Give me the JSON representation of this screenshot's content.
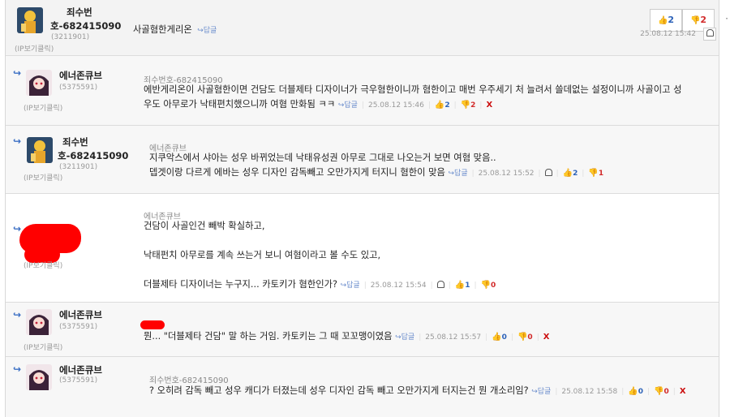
{
  "comments": [
    {
      "name_line1": "죄수번",
      "name_line2": "호-682415090",
      "uid": "(3211901)",
      "ip": "(IP보기클릭)",
      "text": "사골혐한게리온",
      "reply_label": "답글",
      "up": "2",
      "down": "2",
      "time": "25.08.12 15:42"
    },
    {
      "name": "에너존큐브",
      "uid": "(5375591)",
      "ip": "(IP보기클릭)",
      "quote": "죄수번호-682415090",
      "text_line1": "에반게리온이 사골혐한이면 건담도 더블제타 디자이너가 극우혐한이니까 혐한이고 매번 우주세기 처 늘려서 쓸데없는 설정이니까 사골이고 성",
      "text_line2": "우도 아무로가 낙태편치했으니까 여혐 만화됨 ㅋㅋ",
      "reply_label": "답글",
      "time": "25.08.12 15:46",
      "up": "2",
      "down": "2",
      "delete": "X"
    },
    {
      "name_line1": "죄수번",
      "name_line2": "호-682415090",
      "uid": "(3211901)",
      "ip": "(IP보기클릭)",
      "quote": "에너존큐브",
      "text_line1": "지쿠악스에서 샤아는 성우 바뀌었는데 낙태유성권 아무로 그대로 나오는거 보면 여혐 맞음..",
      "text_line2": "뎁겟이랑 다르게 에바는 성우 디자인 감독빼고 오만가지게 터지니 혐한이 맞음",
      "reply_label": "답글",
      "time": "25.08.12 15:52",
      "up": "2",
      "down": "1"
    },
    {
      "ip": "(IP보기클릭)",
      "quote": "에너존큐브",
      "text_line1": "건담이 사골인건 빼박 확실하고,",
      "text_line2": "낙태펀치 아무로를 계속 쓰는거 보니 여혐이라고 볼 수도 있고,",
      "text_line3": "더블제타 디자이너는 누구지... 카토키가 혐한인가?",
      "reply_label": "답글",
      "time": "25.08.12 15:54",
      "up": "1",
      "down": "0"
    },
    {
      "name": "에너존큐브",
      "uid": "(5375591)",
      "ip": "(IP보기클릭)",
      "text": "뭔... \"더블제타 건담\" 말 하는 거임. 카토키는 그 때 꼬꼬맹이였음",
      "reply_label": "답글",
      "time": "25.08.12 15:57",
      "up": "0",
      "down": "0",
      "delete": "X"
    },
    {
      "name": "에너존큐브",
      "uid": "(5375591)",
      "quote": "죄수번호-682415090",
      "text": "? 오히려 감독 빼고 성우 캐디가 터졌는데 성우 디자인 감독 빼고 오만가지게 터지는건 뭔 개소리임?",
      "reply_label": "답글",
      "time": "25.08.12 15:58",
      "up": "0",
      "down": "0",
      "delete": "X"
    }
  ],
  "icons": {
    "reply_arrow": "↪",
    "thumb_up": "thumbs-up-icon",
    "thumb_down": "thumbs-down-icon",
    "bell": "bell-icon"
  },
  "colors": {
    "up": "#2d62b8",
    "down": "#d22b2b",
    "redaction": "#ff0000"
  }
}
